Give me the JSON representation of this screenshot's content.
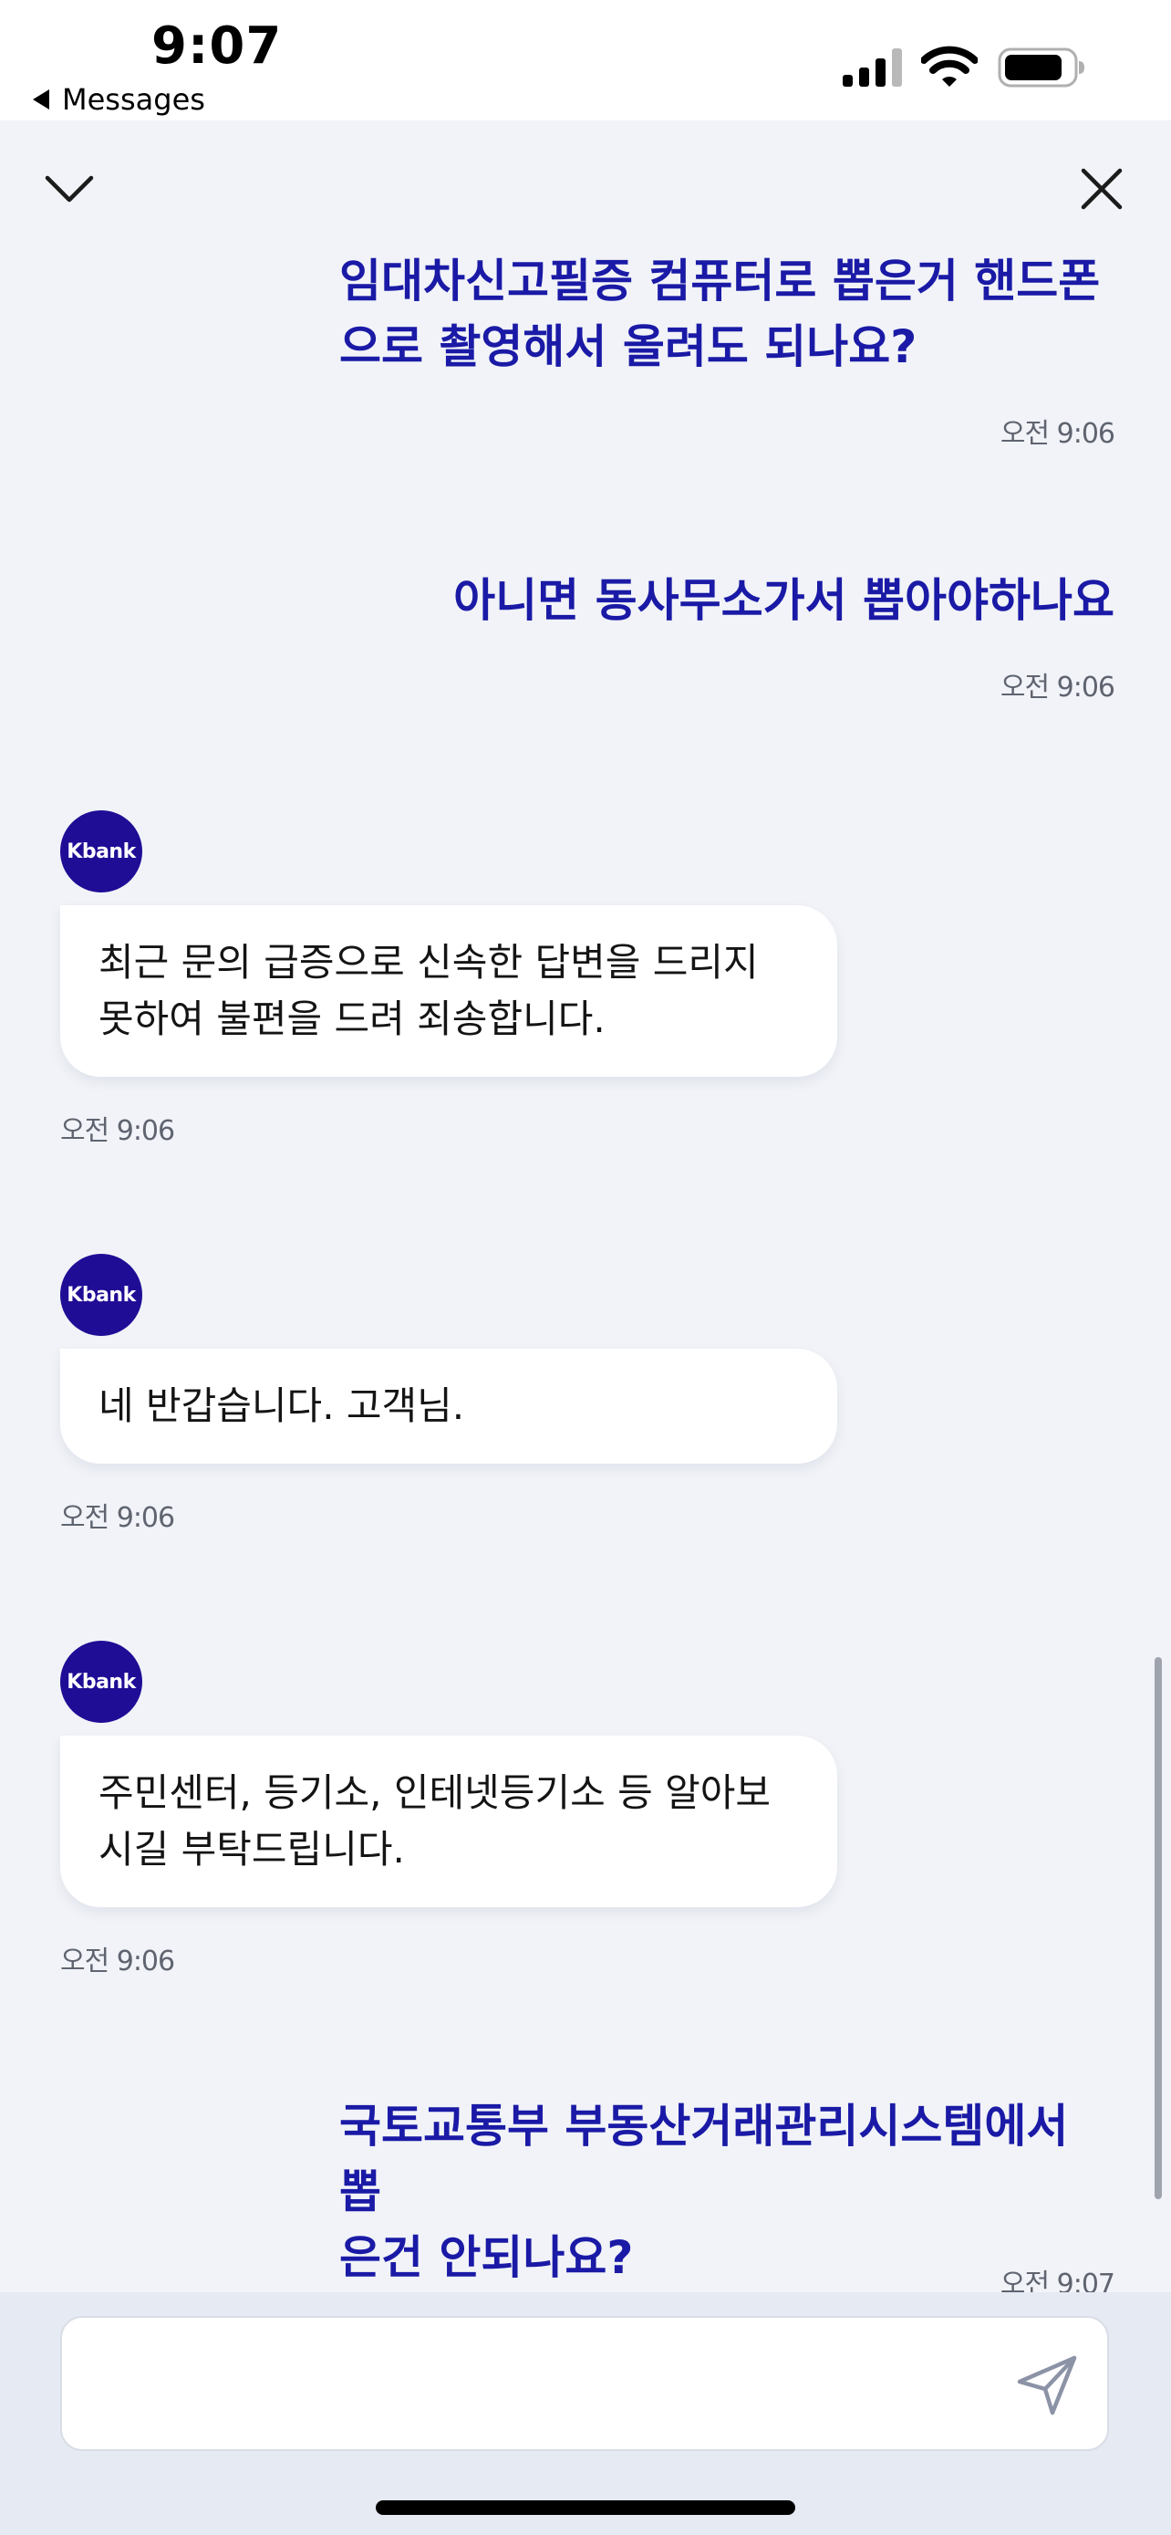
{
  "status_bar": {
    "time": "9:07",
    "back_label": "Messages",
    "icons": [
      "cellular-signal-icon",
      "wifi-icon",
      "battery-icon"
    ]
  },
  "header": {
    "collapse_icon": "chevron-down-icon",
    "close_icon": "close-icon"
  },
  "messages": [
    {
      "sender": "user",
      "lines": [
        "임대차신고필증 컴퓨터로 뽑은거 핸드폰",
        "으로 촬영해서 올려도 되나요?"
      ],
      "time": "오전 9:06"
    },
    {
      "sender": "user",
      "lines": [
        "아니면 동사무소가서 뽑아야하나요"
      ],
      "time": "오전 9:06"
    },
    {
      "sender": "bot",
      "avatar": "Kbank",
      "lines": [
        "최근 문의 급증으로 신속한 답변을 드리지",
        "못하여 불편을 드려 죄송합니다."
      ],
      "time": "오전 9:06"
    },
    {
      "sender": "bot",
      "avatar": "Kbank",
      "lines": [
        "네 반갑습니다. 고객님."
      ],
      "time": "오전 9:06"
    },
    {
      "sender": "bot",
      "avatar": "Kbank",
      "lines": [
        "주민센터, 등기소, 인테넷등기소 등 알아보",
        "시길 부탁드립니다."
      ],
      "time": "오전 9:06"
    },
    {
      "sender": "user",
      "lines": [
        "국토교통부 부동산거래관리시스템에서 뽑",
        "은건 안되나요?"
      ],
      "time": "오전 9:07"
    }
  ],
  "composer": {
    "value": "",
    "placeholder": "",
    "send_icon": "send-icon"
  },
  "colors": {
    "user_text": "#1a1aa6",
    "bot_avatar": "#1f0d96",
    "chat_background": "#f1f3f8",
    "composer_background": "#e6eaf3"
  }
}
